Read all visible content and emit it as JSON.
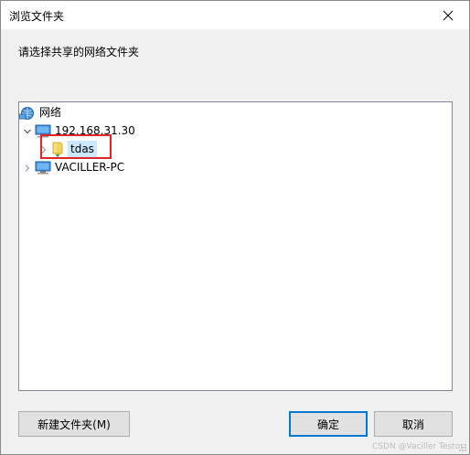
{
  "window": {
    "title": "浏览文件夹",
    "close_label": "×"
  },
  "prompt": "请选择共享的网络文件夹",
  "tree": {
    "root": {
      "label": "网络",
      "icon": "network-icon"
    },
    "host1": {
      "label": "192.168.31.30",
      "icon": "computer-icon",
      "expanded": true
    },
    "share1": {
      "label": "tdas",
      "icon": "shared-folder-icon",
      "selected": true
    },
    "host2": {
      "label": "VACILLER-PC",
      "icon": "computer-icon",
      "expanded": false
    }
  },
  "buttons": {
    "new_folder": "新建文件夹(M)",
    "ok": "确定",
    "cancel": "取消"
  },
  "watermark": "CSDN @Vaciller Testor",
  "colors": {
    "highlight_box": "#e0262b",
    "selection": "#cce8ff",
    "default_button_border": "#0078d7"
  }
}
